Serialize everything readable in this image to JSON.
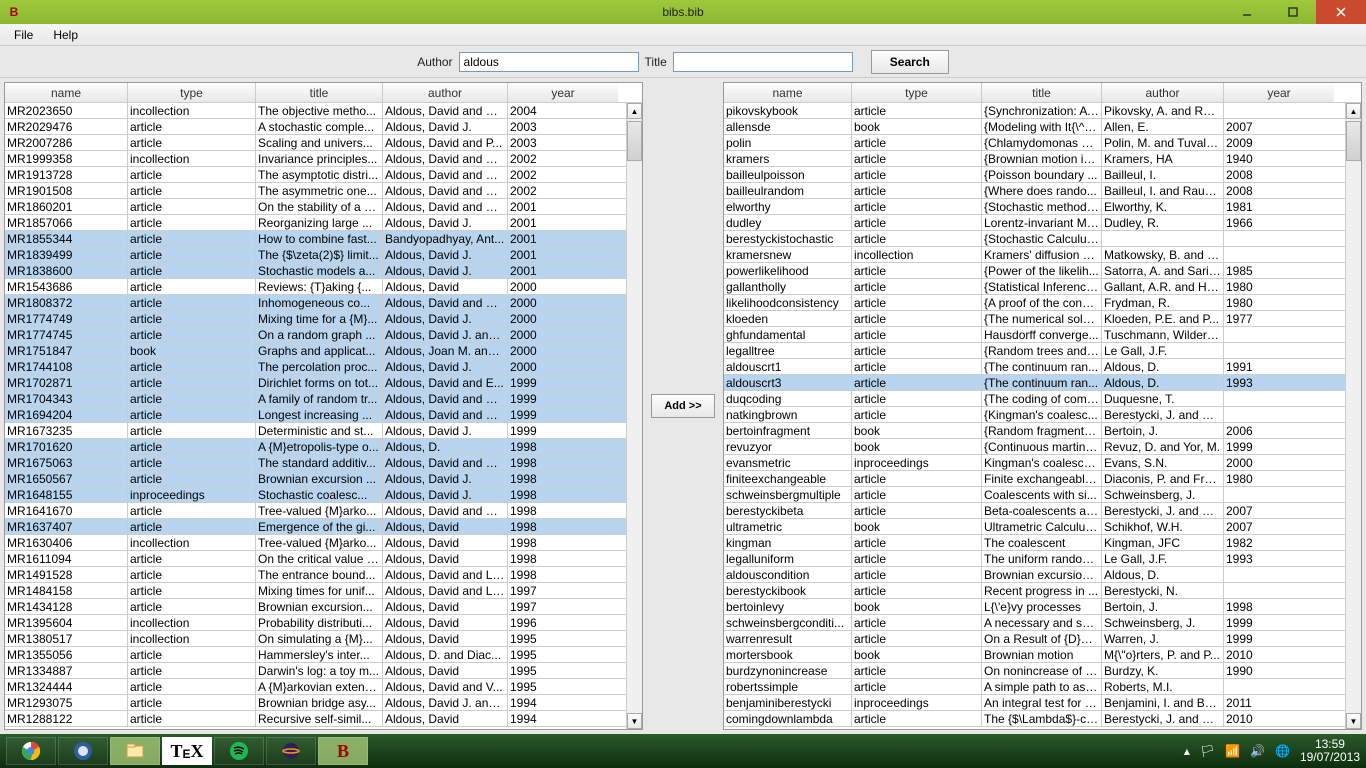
{
  "window": {
    "title": "bibs.bib",
    "app_icon": "B"
  },
  "menu": {
    "file": "File",
    "help": "Help"
  },
  "search": {
    "author_label": "Author",
    "author_value": "aldous",
    "title_label": "Title",
    "title_value": "",
    "button": "Search"
  },
  "headers": [
    "name",
    "type",
    "title",
    "author",
    "year"
  ],
  "add_button": "Add >>",
  "left_rows": [
    {
      "n": "MR2023650",
      "t": "incollection",
      "ti": "The objective metho...",
      "a": "Aldous, David and St...",
      "y": "2004",
      "sel": false
    },
    {
      "n": "MR2029476",
      "t": "article",
      "ti": "A stochastic comple...",
      "a": "Aldous, David J.",
      "y": "2003",
      "sel": false
    },
    {
      "n": "MR2007286",
      "t": "article",
      "ti": "Scaling and univers...",
      "a": "Aldous, David and P...",
      "y": "2003",
      "sel": false
    },
    {
      "n": "MR1999358",
      "t": "incollection",
      "ti": "Invariance principles...",
      "a": "Aldous, David and Pi...",
      "y": "2002",
      "sel": false
    },
    {
      "n": "MR1913728",
      "t": "article",
      "ti": "The asymptotic distri...",
      "a": "Aldous, David and Pi...",
      "y": "2002",
      "sel": false
    },
    {
      "n": "MR1901508",
      "t": "article",
      "ti": "The asymmetric one...",
      "a": "Aldous, David and Pi...",
      "y": "2002",
      "sel": false
    },
    {
      "n": "MR1860201",
      "t": "article",
      "ti": "On the stability of a b...",
      "a": "Aldous, David and Mi...",
      "y": "2001",
      "sel": false
    },
    {
      "n": "MR1857066",
      "t": "article",
      "ti": "Reorganizing large ...",
      "a": "Aldous, David J.",
      "y": "2001",
      "sel": false
    },
    {
      "n": "MR1855344",
      "t": "article",
      "ti": "How to combine fast...",
      "a": "Bandyopadhyay, Ant...",
      "y": "2001",
      "sel": true
    },
    {
      "n": "MR1839499",
      "t": "article",
      "ti": "The {$\\zeta(2)$} limit...",
      "a": "Aldous, David J.",
      "y": "2001",
      "sel": true
    },
    {
      "n": "MR1838600",
      "t": "article",
      "ti": "Stochastic models a...",
      "a": "Aldous, David J.",
      "y": "2001",
      "sel": true
    },
    {
      "n": "MR1543686",
      "t": "article",
      "ti": "Reviews: {T}aking {...",
      "a": "Aldous, David",
      "y": "2000",
      "sel": false
    },
    {
      "n": "MR1808372",
      "t": "article",
      "ti": "Inhomogeneous co...",
      "a": "Aldous, David and Pi...",
      "y": "2000",
      "sel": true
    },
    {
      "n": "MR1774749",
      "t": "article",
      "ti": "Mixing time for a {M}...",
      "a": "Aldous, David J.",
      "y": "2000",
      "sel": true
    },
    {
      "n": "MR1774745",
      "t": "article",
      "ti": "On a random graph ...",
      "a": "Aldous, David J. and ...",
      "y": "2000",
      "sel": true
    },
    {
      "n": "MR1751847",
      "t": "book",
      "ti": "Graphs and applicat...",
      "a": "Aldous, Joan M. and ...",
      "y": "2000",
      "sel": true
    },
    {
      "n": "MR1744108",
      "t": "article",
      "ti": "The percolation proc...",
      "a": "Aldous, David J.",
      "y": "2000",
      "sel": true
    },
    {
      "n": "MR1702871",
      "t": "article",
      "ti": "Dirichlet forms on tot...",
      "a": "Aldous, David and E...",
      "y": "1999",
      "sel": true
    },
    {
      "n": "MR1704343",
      "t": "article",
      "ti": "A family of random tr...",
      "a": "Aldous, David and Pi...",
      "y": "1999",
      "sel": true
    },
    {
      "n": "MR1694204",
      "t": "article",
      "ti": "Longest increasing ...",
      "a": "Aldous, David and Di...",
      "y": "1999",
      "sel": true
    },
    {
      "n": "MR1673235",
      "t": "article",
      "ti": "Deterministic and st...",
      "a": "Aldous, David J.",
      "y": "1999",
      "sel": false
    },
    {
      "n": "MR1701620",
      "t": "article",
      "ti": "A {M}etropolis-type o...",
      "a": "Aldous, D.",
      "y": "1998",
      "sel": true
    },
    {
      "n": "MR1675063",
      "t": "article",
      "ti": "The standard additiv...",
      "a": "Aldous, David and Pi...",
      "y": "1998",
      "sel": true
    },
    {
      "n": "MR1650567",
      "t": "article",
      "ti": "Brownian excursion ...",
      "a": "Aldous, David J.",
      "y": "1998",
      "sel": true
    },
    {
      "n": "MR1648155",
      "t": "inproceedings",
      "ti": "Stochastic coalesc...",
      "a": "Aldous, David J.",
      "y": "1998",
      "sel": true
    },
    {
      "n": "MR1641670",
      "t": "article",
      "ti": "Tree-valued {M}arko...",
      "a": "Aldous, David and Pi...",
      "y": "1998",
      "sel": false
    },
    {
      "n": "MR1637407",
      "t": "article",
      "ti": "Emergence of the gi...",
      "a": "Aldous, David",
      "y": "1998",
      "sel": true
    },
    {
      "n": "MR1630406",
      "t": "incollection",
      "ti": "Tree-valued {M}arko...",
      "a": "Aldous, David",
      "y": "1998",
      "sel": false
    },
    {
      "n": "MR1611094",
      "t": "article",
      "ti": "On the critical value f...",
      "a": "Aldous, David",
      "y": "1998",
      "sel": false
    },
    {
      "n": "MR1491528",
      "t": "article",
      "ti": "The entrance bound...",
      "a": "Aldous, David and Li...",
      "y": "1998",
      "sel": false
    },
    {
      "n": "MR1484158",
      "t": "article",
      "ti": "Mixing times for unif...",
      "a": "Aldous, David and Li...",
      "y": "1997",
      "sel": false
    },
    {
      "n": "MR1434128",
      "t": "article",
      "ti": "Brownian excursion...",
      "a": "Aldous, David",
      "y": "1997",
      "sel": false
    },
    {
      "n": "MR1395604",
      "t": "incollection",
      "ti": "Probability distributi...",
      "a": "Aldous, David",
      "y": "1996",
      "sel": false
    },
    {
      "n": "MR1380517",
      "t": "incollection",
      "ti": "On simulating a {M}...",
      "a": "Aldous, David",
      "y": "1995",
      "sel": false
    },
    {
      "n": "MR1355056",
      "t": "article",
      "ti": "Hammersley's inter...",
      "a": "Aldous, D. and Diac...",
      "y": "1995",
      "sel": false
    },
    {
      "n": "MR1334887",
      "t": "article",
      "ti": "Darwin's log: a toy m...",
      "a": "Aldous, David",
      "y": "1995",
      "sel": false
    },
    {
      "n": "MR1324444",
      "t": "article",
      "ti": "A {M}arkovian extens...",
      "a": "Aldous, David and V...",
      "y": "1995",
      "sel": false
    },
    {
      "n": "MR1293075",
      "t": "article",
      "ti": "Brownian bridge asy...",
      "a": "Aldous, David J. and ...",
      "y": "1994",
      "sel": false
    },
    {
      "n": "MR1288122",
      "t": "article",
      "ti": "Recursive self-simil...",
      "a": "Aldous, David",
      "y": "1994",
      "sel": false
    }
  ],
  "right_rows": [
    {
      "n": "pikovskybook",
      "t": "article",
      "ti": "{Synchronization: A u...",
      "a": "Pikovsky, A. and Ros...",
      "y": "",
      "sel": false
    },
    {
      "n": "allensde",
      "t": "book",
      "ti": "{Modeling with It{\\^o}...",
      "a": "Allen, E.",
      "y": "2007",
      "sel": false
    },
    {
      "n": "polin",
      "t": "article",
      "ti": "{Chlamydomonas S...",
      "a": "Polin, M. and Tuval, I....",
      "y": "2009",
      "sel": false
    },
    {
      "n": "kramers",
      "t": "article",
      "ti": "{Brownian motion in ...",
      "a": "Kramers, HA",
      "y": "1940",
      "sel": false
    },
    {
      "n": "bailleulpoisson",
      "t": "article",
      "ti": "{Poisson boundary ...",
      "a": "Bailleul, I.",
      "y": "2008",
      "sel": false
    },
    {
      "n": "bailleulrandom",
      "t": "article",
      "ti": "{Where does rando...",
      "a": "Bailleul, I. and Raugi...",
      "y": "2008",
      "sel": false
    },
    {
      "n": "elworthy",
      "t": "article",
      "ti": "{Stochastic methods...",
      "a": "Elworthy, K.",
      "y": "1981",
      "sel": false
    },
    {
      "n": "dudley",
      "t": "article",
      "ti": "Lorentz-invariant Mar...",
      "a": "Dudley, R.",
      "y": "1966",
      "sel": false
    },
    {
      "n": "berestyckistochastic",
      "t": "article",
      "ti": "{Stochastic Calculus...",
      "a": "",
      "y": "",
      "sel": false
    },
    {
      "n": "kramersnew",
      "t": "incollection",
      "ti": "Kramers' diffusion p...",
      "a": "Matkowsky, B. and S...",
      "y": "",
      "sel": false
    },
    {
      "n": "powerlikelihood",
      "t": "article",
      "ti": "{Power of the likelih...",
      "a": "Satorra, A. and Saris...",
      "y": "1985",
      "sel": false
    },
    {
      "n": "gallantholly",
      "t": "article",
      "ti": "{Statistical Inference...",
      "a": "Gallant, A.R. and Hol...",
      "y": "1980",
      "sel": false
    },
    {
      "n": "likelihoodconsistency",
      "t": "article",
      "ti": "{A proof of the consi...",
      "a": "Frydman, R.",
      "y": "1980",
      "sel": false
    },
    {
      "n": "kloeden",
      "t": "article",
      "ti": "{The numerical solut...",
      "a": "Kloeden, P.E. and P...",
      "y": "1977",
      "sel": false
    },
    {
      "n": "ghfundamental",
      "t": "article",
      "ti": "Hausdorff converge...",
      "a": "Tuschmann, Wilderich",
      "y": "",
      "sel": false
    },
    {
      "n": "legalltree",
      "t": "article",
      "ti": "{Random trees and ...",
      "a": "Le Gall, J.F.",
      "y": "",
      "sel": false
    },
    {
      "n": "aldouscrt1",
      "t": "article",
      "ti": "{The continuum ran...",
      "a": "Aldous, D.",
      "y": "1991",
      "sel": false
    },
    {
      "n": "aldouscrt3",
      "t": "article",
      "ti": "{The continuum ran...",
      "a": "Aldous, D.",
      "y": "1993",
      "sel": true
    },
    {
      "n": "duqcoding",
      "t": "article",
      "ti": "{The coding of comp...",
      "a": "Duquesne, T.",
      "y": "",
      "sel": false
    },
    {
      "n": "natkingbrown",
      "t": "article",
      "ti": "{Kingman's coalesc...",
      "a": "Berestycki, J. and Be...",
      "y": "",
      "sel": false
    },
    {
      "n": "bertoinfragment",
      "t": "book",
      "ti": "{Random fragmenta...",
      "a": "Bertoin, J.",
      "y": "2006",
      "sel": false
    },
    {
      "n": "revuzyor",
      "t": "book",
      "ti": "{Continuous marting...",
      "a": "Revuz, D. and Yor, M.",
      "y": "1999",
      "sel": false
    },
    {
      "n": "evansmetric",
      "t": "inproceedings",
      "ti": "Kingman's coalesce...",
      "a": "Evans, S.N.",
      "y": "2000",
      "sel": false
    },
    {
      "n": "finiteexchangeable",
      "t": "article",
      "ti": "Finite exchangeable ...",
      "a": "Diaconis, P. and Fre...",
      "y": "1980",
      "sel": false
    },
    {
      "n": "schweinsbergmultiple",
      "t": "article",
      "ti": "Coalescents with si...",
      "a": "Schweinsberg, J.",
      "y": "",
      "sel": false
    },
    {
      "n": "berestyckibeta",
      "t": "article",
      "ti": "Beta-coalescents an...",
      "a": "Berestycki, J. and Be...",
      "y": "2007",
      "sel": false
    },
    {
      "n": "ultrametric",
      "t": "book",
      "ti": "Ultrametric Calculus...",
      "a": "Schikhof, W.H.",
      "y": "2007",
      "sel": false
    },
    {
      "n": "kingman",
      "t": "article",
      "ti": "The coalescent",
      "a": "Kingman, JFC",
      "y": "1982",
      "sel": false
    },
    {
      "n": "legalluniform",
      "t": "article",
      "ti": "The uniform random...",
      "a": "Le Gall, J.F.",
      "y": "1993",
      "sel": false
    },
    {
      "n": "aldouscondition",
      "t": "article",
      "ti": "Brownian excursion ...",
      "a": "Aldous, D.",
      "y": "",
      "sel": false
    },
    {
      "n": "berestyckibook",
      "t": "article",
      "ti": "Recent progress in ...",
      "a": "Berestycki, N.",
      "y": "",
      "sel": false
    },
    {
      "n": "bertoinlevy",
      "t": "book",
      "ti": "L{\\'e}vy processes",
      "a": "Bertoin, J.",
      "y": "1998",
      "sel": false
    },
    {
      "n": "schweinsbergconditi...",
      "t": "article",
      "ti": "A necessary and suf...",
      "a": "Schweinsberg, J.",
      "y": "1999",
      "sel": false
    },
    {
      "n": "warrenresult",
      "t": "article",
      "ti": "On a Result of {D}avi...",
      "a": "Warren, J.",
      "y": "1999",
      "sel": false
    },
    {
      "n": "mortersbook",
      "t": "book",
      "ti": "Brownian motion",
      "a": "M{\\\"o}rters, P. and P...",
      "y": "2010",
      "sel": false
    },
    {
      "n": "burdzynonincrease",
      "t": "article",
      "ti": "On nonincrease of B...",
      "a": "Burdzy, K.",
      "y": "1990",
      "sel": false
    },
    {
      "n": "robertssimple",
      "t": "article",
      "ti": "A simple path to asy...",
      "a": "Roberts, M.I.",
      "y": "",
      "sel": false
    },
    {
      "n": "benjaminiberestycki",
      "t": "inproceedings",
      "ti": "An integral test for th...",
      "a": "Benjamini, I. and Ber...",
      "y": "2011",
      "sel": false
    },
    {
      "n": "comingdownlambda",
      "t": "article",
      "ti": "The {$\\Lambda$}-coa...",
      "a": "Berestycki, J. and Be...",
      "y": "2010",
      "sel": false
    }
  ],
  "clock": {
    "time": "13:59",
    "date": "19/07/2013"
  }
}
